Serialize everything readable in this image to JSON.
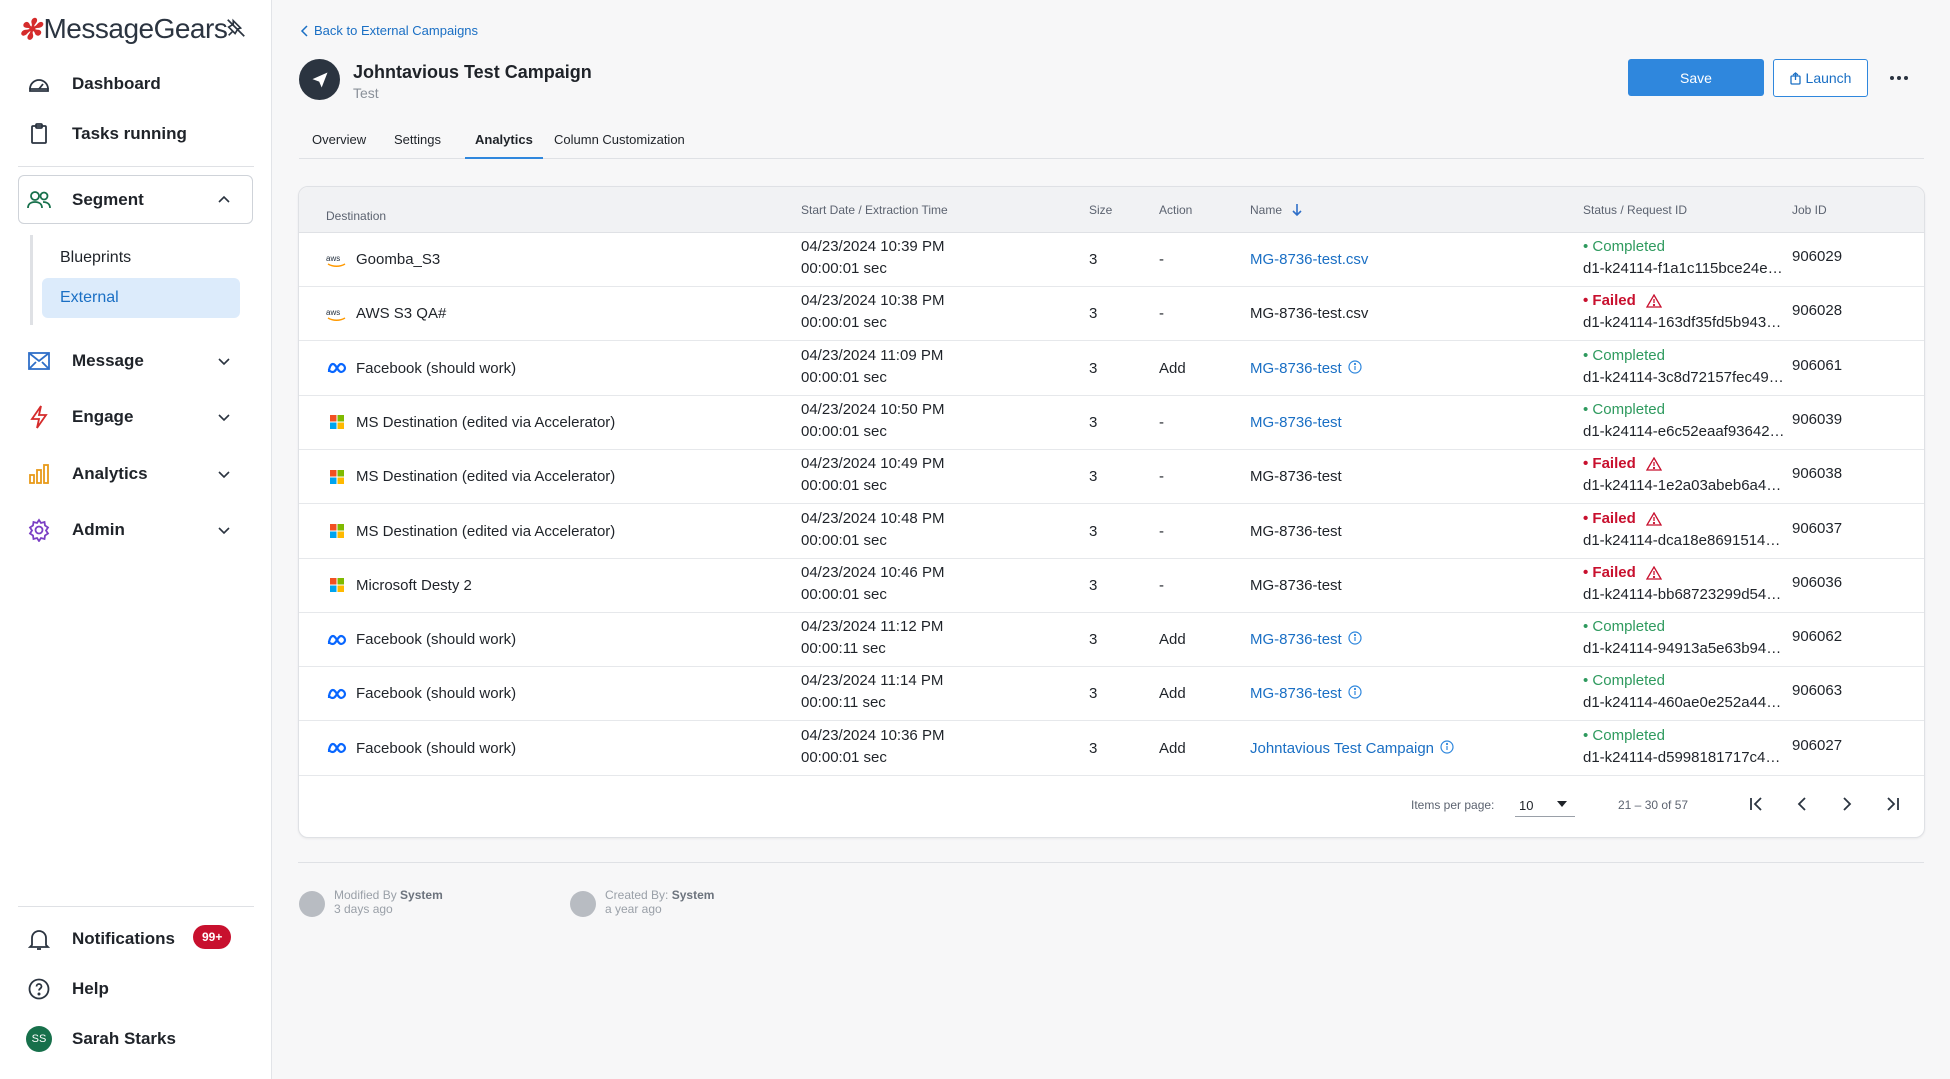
{
  "app": {
    "logo_mark": "✻",
    "logo_text": "MessageGears"
  },
  "sidebar": {
    "dashboard": "Dashboard",
    "tasks": "Tasks running",
    "segment": "Segment",
    "segment_items": [
      "Blueprints",
      "External"
    ],
    "message": "Message",
    "engage": "Engage",
    "analytics": "Analytics",
    "admin": "Admin",
    "notifications": "Notifications",
    "notifications_badge": "99+",
    "help": "Help",
    "user_initials": "SS",
    "user_name": "Sarah Starks"
  },
  "header": {
    "back_link": "Back to External Campaigns",
    "title": "Johntavious Test Campaign",
    "subtitle": "Test",
    "save_label": "Save",
    "launch_label": "Launch"
  },
  "tabs": [
    "Overview",
    "Settings",
    "Analytics",
    "Column Customization"
  ],
  "table": {
    "headers": {
      "destination": "Destination",
      "start": "Start Date / Extraction Time",
      "size": "Size",
      "action": "Action",
      "name": "Name",
      "status": "Status / Request ID",
      "job": "Job ID"
    },
    "rows": [
      {
        "icon": "aws",
        "dest": "Goomba_S3",
        "date": "04/23/2024 10:39 PM",
        "time": "00:00:01 sec",
        "size": "3",
        "action": "-",
        "name": "MG-8736-test.csv",
        "name_link": true,
        "info": false,
        "status": "Completed",
        "ok": true,
        "req": "d1-k24114-f1a1c115bce24e…",
        "job": "906029"
      },
      {
        "icon": "aws",
        "dest": "AWS S3 QA#",
        "date": "04/23/2024 10:38 PM",
        "time": "00:00:01 sec",
        "size": "3",
        "action": "-",
        "name": "MG-8736-test.csv",
        "name_link": false,
        "info": false,
        "status": "Failed",
        "ok": false,
        "req": "d1-k24114-163df35fd5b943…",
        "job": "906028"
      },
      {
        "icon": "meta",
        "dest": "Facebook (should work)",
        "date": "04/23/2024 11:09 PM",
        "time": "00:00:01 sec",
        "size": "3",
        "action": "Add",
        "name": "MG-8736-test",
        "name_link": true,
        "info": true,
        "status": "Completed",
        "ok": true,
        "req": "d1-k24114-3c8d72157fec49…",
        "job": "906061"
      },
      {
        "icon": "ms",
        "dest": "MS Destination (edited via Accelerator)",
        "date": "04/23/2024 10:50 PM",
        "time": "00:00:01 sec",
        "size": "3",
        "action": "-",
        "name": "MG-8736-test",
        "name_link": true,
        "info": false,
        "status": "Completed",
        "ok": true,
        "req": "d1-k24114-e6c52eaaf93642…",
        "job": "906039"
      },
      {
        "icon": "ms",
        "dest": "MS Destination (edited via Accelerator)",
        "date": "04/23/2024 10:49 PM",
        "time": "00:00:01 sec",
        "size": "3",
        "action": "-",
        "name": "MG-8736-test",
        "name_link": false,
        "info": false,
        "status": "Failed",
        "ok": false,
        "req": "d1-k24114-1e2a03abeb6a4…",
        "job": "906038"
      },
      {
        "icon": "ms",
        "dest": "MS Destination (edited via Accelerator)",
        "date": "04/23/2024 10:48 PM",
        "time": "00:00:01 sec",
        "size": "3",
        "action": "-",
        "name": "MG-8736-test",
        "name_link": false,
        "info": false,
        "status": "Failed",
        "ok": false,
        "req": "d1-k24114-dca18e8691514…",
        "job": "906037"
      },
      {
        "icon": "ms",
        "dest": "Microsoft Desty 2",
        "date": "04/23/2024 10:46 PM",
        "time": "00:00:01 sec",
        "size": "3",
        "action": "-",
        "name": "MG-8736-test",
        "name_link": false,
        "info": false,
        "status": "Failed",
        "ok": false,
        "req": "d1-k24114-bb68723299d54…",
        "job": "906036"
      },
      {
        "icon": "meta",
        "dest": "Facebook (should work)",
        "date": "04/23/2024 11:12 PM",
        "time": "00:00:11 sec",
        "size": "3",
        "action": "Add",
        "name": "MG-8736-test",
        "name_link": true,
        "info": true,
        "status": "Completed",
        "ok": true,
        "req": "d1-k24114-94913a5e63b94…",
        "job": "906062"
      },
      {
        "icon": "meta",
        "dest": "Facebook (should work)",
        "date": "04/23/2024 11:14 PM",
        "time": "00:00:11 sec",
        "size": "3",
        "action": "Add",
        "name": "MG-8736-test",
        "name_link": true,
        "info": true,
        "status": "Completed",
        "ok": true,
        "req": "d1-k24114-460ae0e252a44…",
        "job": "906063"
      },
      {
        "icon": "meta",
        "dest": "Facebook (should work)",
        "date": "04/23/2024 10:36 PM",
        "time": "00:00:01 sec",
        "size": "3",
        "action": "Add",
        "name": "Johntavious Test Campaign",
        "name_link": true,
        "info": true,
        "status": "Completed",
        "ok": true,
        "req": "d1-k24114-d5998181717c4…",
        "job": "906027"
      }
    ]
  },
  "pagination": {
    "items_label": "Items per page:",
    "per_page": "10",
    "range": "21 – 30 of 57"
  },
  "footer": {
    "modified_label": "Modified By",
    "modified_by": "System",
    "modified_ago": "3 days ago",
    "created_label": "Created By:",
    "created_by": "System",
    "created_ago": "a year ago"
  },
  "colors": {
    "accent": "#2f87dd",
    "success": "#2e9a5e",
    "danger": "#c8102e"
  }
}
